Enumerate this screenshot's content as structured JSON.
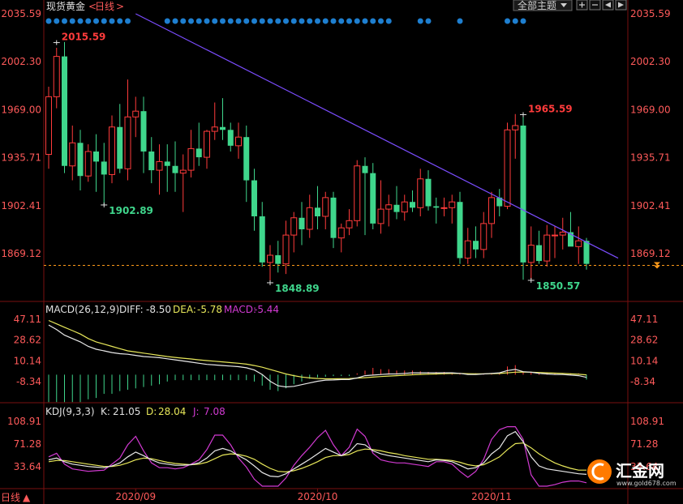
{
  "header": {
    "title": "现货黄金",
    "period_label": "日线",
    "arrow": ">",
    "theme_label": "全部主题",
    "period_bottom": "日线",
    "period_arrow": "▲"
  },
  "watermark": {
    "brand": "汇金网",
    "url": "www.gold678.com"
  },
  "colors": {
    "up": "#ff3b3b",
    "down": "#3fd68c",
    "yellow": "#e8e85a",
    "magenta": "#d23ad2",
    "white": "#e8e8e8",
    "trend": "#7b4dff",
    "dot": "#1e7fd0",
    "price_line": "#ff9a1a",
    "axis_red": "#ff5a5a",
    "axis_white": "#e0e0e0"
  },
  "chart_data": {
    "main": {
      "type": "candlestick",
      "y_ticks": [
        2035.59,
        2002.3,
        1969.0,
        1935.71,
        1902.41,
        1869.12
      ],
      "y_tick_labels": [
        "2035.59",
        "2002.30",
        "1969.00",
        "1935.71",
        "1902.41",
        "1869.12"
      ],
      "x_labels": [
        "2020/09",
        "2020/10",
        "2020/11"
      ],
      "x_label_index": [
        11,
        34,
        56
      ],
      "annotations": [
        {
          "text": "2015.59",
          "index": 1,
          "value": 2015.59,
          "kind": "high"
        },
        {
          "text": "1902.89",
          "index": 7,
          "value": 1902.89,
          "kind": "low"
        },
        {
          "text": "1848.89",
          "index": 28,
          "value": 1848.89,
          "kind": "low"
        },
        {
          "text": "1965.59",
          "index": 60,
          "value": 1965.59,
          "kind": "high"
        },
        {
          "text": "1850.57",
          "index": 61,
          "value": 1850.57,
          "kind": "low"
        }
      ],
      "current_price": 1861.0,
      "trendline": [
        {
          "index": 11,
          "value": 2035.59
        },
        {
          "index": 72,
          "value": 1866.0
        }
      ],
      "event_dots_index": [
        0,
        1,
        2,
        3,
        4,
        5,
        6,
        7,
        8,
        9,
        10,
        15,
        16,
        17,
        18,
        19,
        20,
        21,
        22,
        23,
        24,
        25,
        26,
        27,
        28,
        29,
        30,
        31,
        32,
        33,
        34,
        35,
        36,
        37,
        38,
        39,
        40,
        41,
        42,
        43,
        47,
        48,
        52,
        58,
        59,
        60
      ],
      "candles": [
        [
          1938,
          1985,
          1928,
          1978
        ],
        [
          1978,
          2012,
          1970,
          2006
        ],
        [
          2006,
          2016,
          1925,
          1930
        ],
        [
          1930,
          1958,
          1920,
          1946
        ],
        [
          1946,
          1955,
          1913,
          1923
        ],
        [
          1923,
          1945,
          1919,
          1940
        ],
        [
          1940,
          1952,
          1912,
          1933
        ],
        [
          1933,
          1946,
          1903,
          1924
        ],
        [
          1924,
          1965,
          1918,
          1957
        ],
        [
          1957,
          1973,
          1925,
          1928
        ],
        [
          1928,
          1990,
          1920,
          1964
        ],
        [
          1964,
          1978,
          1950,
          1968
        ],
        [
          1968,
          1978,
          1925,
          1940
        ],
        [
          1940,
          1950,
          1918,
          1927
        ],
        [
          1927,
          1945,
          1910,
          1933
        ],
        [
          1933,
          1945,
          1912,
          1930
        ],
        [
          1930,
          1947,
          1912,
          1925
        ],
        [
          1925,
          1938,
          1898,
          1927
        ],
        [
          1927,
          1955,
          1922,
          1942
        ],
        [
          1942,
          1960,
          1930,
          1936
        ],
        [
          1936,
          1955,
          1928,
          1954
        ],
        [
          1954,
          1974,
          1948,
          1957
        ],
        [
          1957,
          1977,
          1948,
          1955
        ],
        [
          1955,
          1960,
          1940,
          1944
        ],
        [
          1944,
          1960,
          1935,
          1950
        ],
        [
          1950,
          1958,
          1905,
          1920
        ],
        [
          1920,
          1928,
          1885,
          1895
        ],
        [
          1895,
          1905,
          1860,
          1863
        ],
        [
          1863,
          1875,
          1848,
          1868
        ],
        [
          1868,
          1878,
          1856,
          1862
        ],
        [
          1862,
          1892,
          1855,
          1882
        ],
        [
          1882,
          1898,
          1870,
          1894
        ],
        [
          1894,
          1905,
          1875,
          1886
        ],
        [
          1886,
          1910,
          1880,
          1901
        ],
        [
          1901,
          1916,
          1886,
          1895
        ],
        [
          1895,
          1912,
          1886,
          1908
        ],
        [
          1908,
          1912,
          1873,
          1880
        ],
        [
          1880,
          1890,
          1870,
          1887
        ],
        [
          1887,
          1900,
          1882,
          1892
        ],
        [
          1892,
          1934,
          1888,
          1930
        ],
        [
          1930,
          1936,
          1882,
          1925
        ],
        [
          1925,
          1932,
          1886,
          1890
        ],
        [
          1890,
          1920,
          1883,
          1900
        ],
        [
          1900,
          1910,
          1888,
          1903
        ],
        [
          1903,
          1916,
          1893,
          1898
        ],
        [
          1898,
          1910,
          1892,
          1905
        ],
        [
          1905,
          1913,
          1898,
          1901
        ],
        [
          1901,
          1928,
          1895,
          1921
        ],
        [
          1921,
          1927,
          1899,
          1902
        ],
        [
          1902,
          1908,
          1890,
          1901
        ],
        [
          1901,
          1908,
          1895,
          1901
        ],
        [
          1901,
          1910,
          1890,
          1905
        ],
        [
          1905,
          1912,
          1862,
          1866
        ],
        [
          1866,
          1887,
          1862,
          1878
        ],
        [
          1878,
          1888,
          1866,
          1872
        ],
        [
          1872,
          1898,
          1866,
          1890
        ],
        [
          1890,
          1912,
          1880,
          1908
        ],
        [
          1908,
          1914,
          1895,
          1902
        ],
        [
          1902,
          1960,
          1900,
          1955
        ],
        [
          1955,
          1966,
          1935,
          1958
        ],
        [
          1958,
          1966,
          1851,
          1863
        ],
        [
          1863,
          1888,
          1851,
          1875
        ],
        [
          1875,
          1885,
          1862,
          1864
        ],
        [
          1864,
          1889,
          1860,
          1882
        ],
        [
          1882,
          1888,
          1866,
          1882
        ],
        [
          1882,
          1894,
          1872,
          1884
        ],
        [
          1884,
          1898,
          1875,
          1874
        ],
        [
          1874,
          1888,
          1862,
          1878
        ],
        [
          1878,
          1880,
          1858,
          1862
        ]
      ]
    },
    "macd": {
      "params": "MACD(26,12,9)",
      "diff_label": "DIFF:",
      "diff_value": "-8.50",
      "dea_label": "DEA:",
      "dea_value": "-5.78",
      "macd_label": "MACD:",
      "macd_value": "-5.44",
      "y_ticks": [
        47.11,
        28.62,
        10.14,
        -8.34
      ],
      "y_tick_labels": [
        "47.11",
        "28.62",
        "10.14",
        "-8.34"
      ],
      "diff": [
        42.0,
        38.0,
        33.0,
        30.0,
        27.0,
        23.0,
        20.5,
        19.0,
        17.5,
        16.5,
        16.0,
        15.0,
        14.0,
        13.5,
        13.0,
        12.0,
        11.0,
        10.0,
        9.0,
        8.0,
        7.0,
        6.5,
        6.0,
        5.5,
        5.0,
        4.0,
        2.0,
        -2.0,
        -8.0,
        -12.0,
        -13.0,
        -12.5,
        -11.0,
        -9.5,
        -8.0,
        -7.0,
        -6.8,
        -6.5,
        -6.5,
        -5.0,
        -3.0,
        -2.5,
        -2.0,
        -1.5,
        -1.5,
        -1.0,
        -0.5,
        -0.5,
        -0.5,
        -0.5,
        -0.5,
        -0.5,
        -1.0,
        -2.0,
        -2.0,
        -1.5,
        -1.0,
        -0.5,
        1.5,
        2.5,
        0.5,
        0.0,
        -1.0,
        -1.5,
        -2.0,
        -2.0,
        -2.5,
        -3.0,
        -4.5
      ],
      "dea": [
        46.0,
        43.0,
        40.0,
        37.0,
        34.0,
        30.0,
        27.0,
        25.0,
        23.0,
        21.0,
        19.0,
        18.0,
        17.0,
        16.0,
        15.0,
        14.0,
        13.2,
        12.5,
        11.8,
        11.0,
        10.4,
        9.8,
        9.2,
        8.6,
        8.0,
        7.2,
        6.0,
        4.5,
        2.5,
        0.5,
        -1.5,
        -3.0,
        -4.2,
        -5.0,
        -5.5,
        -5.8,
        -5.8,
        -5.7,
        -5.6,
        -5.2,
        -4.8,
        -4.3,
        -3.8,
        -3.4,
        -3.0,
        -2.6,
        -2.2,
        -1.9,
        -1.7,
        -1.5,
        -1.3,
        -1.1,
        -1.1,
        -1.3,
        -1.4,
        -1.4,
        -1.3,
        -1.1,
        -0.5,
        0.1,
        0.2,
        0.1,
        -0.2,
        -0.5,
        -0.8,
        -1.1,
        -1.4,
        -1.8,
        -2.3
      ],
      "hist": [
        -20.0,
        -20.0,
        -20.0,
        -20.0,
        -20.0,
        -18.0,
        -17.0,
        -14.0,
        -14.0,
        -12.0,
        -11.0,
        -10.0,
        -9.0,
        -8.0,
        -7.0,
        -5.0,
        -4.0,
        -4.0,
        -4.0,
        -4.0,
        -4.0,
        -4.0,
        -4.0,
        -4.0,
        -4.0,
        -4.0,
        -5.0,
        -8.0,
        -11.0,
        -12.0,
        -10.0,
        -7.0,
        -5.0,
        -3.0,
        -2.0,
        -1.5,
        -1.0,
        -1.0,
        -1.0,
        1.0,
        3.0,
        5.0,
        4.0,
        4.0,
        3.0,
        3.0,
        3.0,
        2.5,
        2.0,
        2.0,
        2.0,
        1.5,
        1.0,
        1.0,
        1.0,
        0.5,
        1.0,
        1.5,
        6.0,
        7.0,
        2.5,
        2.0,
        1.5,
        1.5,
        1.0,
        1.0,
        1.0,
        1.0,
        -3.5
      ]
    },
    "kdj": {
      "params": "KDJ(9,3,3)",
      "k_label": "K:",
      "k_value": "21.05",
      "d_label": "D:",
      "d_value": "28.04",
      "j_label": "J:",
      "j_value": "7.08",
      "y_ticks": [
        108.91,
        71.28,
        33.64
      ],
      "y_tick_labels": [
        "108.91",
        "71.28",
        "33.64"
      ],
      "k": [
        45,
        48,
        42,
        38,
        36,
        34,
        33,
        32,
        35,
        40,
        50,
        58,
        52,
        45,
        40,
        38,
        36,
        36,
        37,
        40,
        48,
        60,
        64,
        60,
        52,
        45,
        35,
        24,
        18,
        17,
        22,
        30,
        38,
        46,
        55,
        64,
        58,
        52,
        58,
        72,
        70,
        60,
        55,
        52,
        50,
        48,
        46,
        44,
        42,
        45,
        44,
        42,
        36,
        30,
        32,
        40,
        55,
        65,
        85,
        92,
        75,
        50,
        35,
        30,
        28,
        26,
        24,
        22,
        21
      ],
      "d": [
        42,
        44,
        44,
        42,
        40,
        38,
        36,
        34,
        34,
        36,
        40,
        45,
        48,
        47,
        44,
        41,
        39,
        38,
        37,
        38,
        41,
        47,
        53,
        55,
        54,
        51,
        46,
        38,
        31,
        26,
        25,
        27,
        31,
        36,
        42,
        49,
        52,
        52,
        54,
        60,
        63,
        62,
        60,
        57,
        55,
        52,
        50,
        48,
        46,
        46,
        45,
        44,
        41,
        37,
        35,
        37,
        43,
        50,
        62,
        72,
        73,
        65,
        55,
        47,
        40,
        35,
        31,
        28,
        28
      ],
      "j": [
        50,
        56,
        38,
        30,
        28,
        26,
        27,
        28,
        38,
        48,
        70,
        84,
        60,
        40,
        32,
        32,
        30,
        32,
        38,
        45,
        62,
        86,
        86,
        70,
        48,
        33,
        13,
        0,
        0,
        0,
        15,
        36,
        52,
        66,
        82,
        94,
        70,
        52,
        66,
        96,
        84,
        56,
        45,
        42,
        40,
        40,
        38,
        36,
        34,
        42,
        42,
        38,
        26,
        16,
        26,
        46,
        79,
        95,
        100,
        100,
        79,
        20,
        0,
        0,
        4,
        8,
        10,
        10,
        7
      ]
    }
  }
}
